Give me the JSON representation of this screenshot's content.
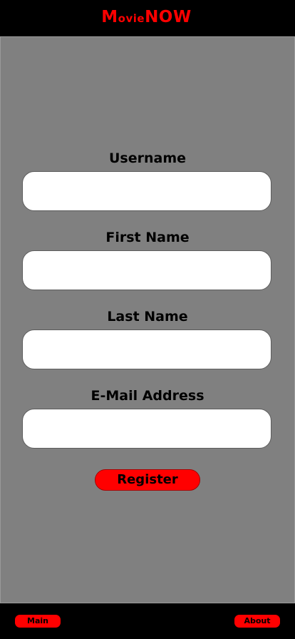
{
  "header": {
    "logo": {
      "m": "M",
      "ovie": "ovie",
      "now": "NOW"
    }
  },
  "form": {
    "username_label": "Username",
    "username_value": "",
    "firstname_label": "First Name",
    "firstname_value": "",
    "lastname_label": "Last Name",
    "lastname_value": "",
    "email_label": "E-Mail Address",
    "email_value": "",
    "register_label": "Register"
  },
  "footer": {
    "main_label": "Main",
    "about_label": "About"
  },
  "colors": {
    "brand": "#ff0000",
    "background": "#808080",
    "bar": "#000000"
  }
}
